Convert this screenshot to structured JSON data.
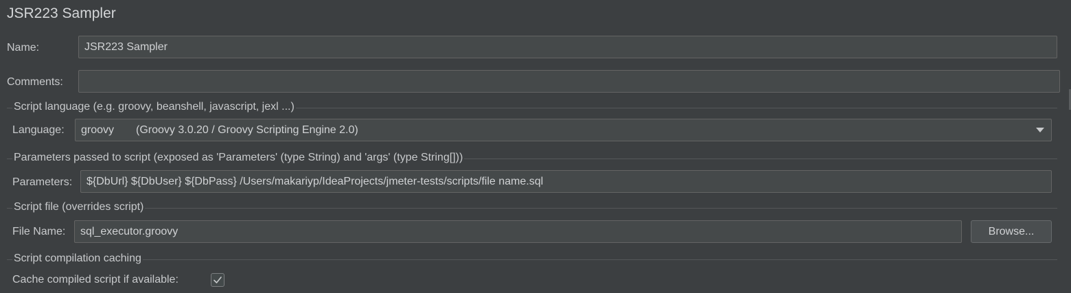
{
  "title": "JSR223 Sampler",
  "name": {
    "label": "Name:",
    "value": "JSR223 Sampler"
  },
  "comments": {
    "label": "Comments:",
    "value": ""
  },
  "script_language_section": {
    "title": "Script language (e.g. groovy, beanshell, javascript, jexl ...)",
    "language_label": "Language:",
    "language_value": "groovy",
    "language_desc": "(Groovy 3.0.20 / Groovy Scripting Engine 2.0)"
  },
  "parameters_section": {
    "title": "Parameters passed to script (exposed as 'Parameters' (type String) and 'args' (type String[]))",
    "parameters_label": "Parameters:",
    "parameters_value": "${DbUrl} ${DbUser} ${DbPass} /Users/makariyp/IdeaProjects/jmeter-tests/scripts/file name.sql"
  },
  "script_file_section": {
    "title": "Script file (overrides script)",
    "file_name_label": "File Name:",
    "file_name_value": "sql_executor.groovy",
    "browse_label": "Browse..."
  },
  "caching_section": {
    "title": "Script compilation caching",
    "cache_label": "Cache compiled script if available:",
    "cache_checked": true
  }
}
